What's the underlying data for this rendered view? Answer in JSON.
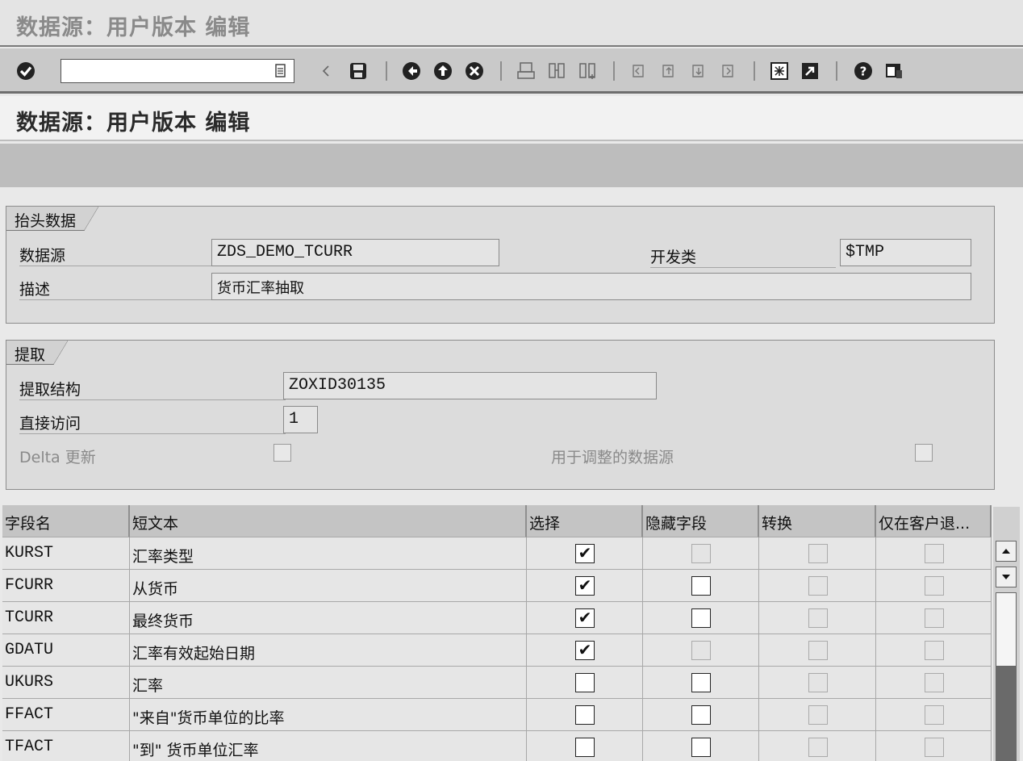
{
  "window": {
    "title": "数据源：用户版本 编辑"
  },
  "toolbar": {
    "command_value": "",
    "icons": [
      "enter-icon",
      "command-history-icon",
      "back-arrow-icon",
      "save-icon",
      "back-icon",
      "exit-icon",
      "cancel-icon",
      "print-icon",
      "find-icon",
      "find-next-icon",
      "first-page-icon",
      "previous-page-icon",
      "next-page-icon",
      "last-page-icon",
      "new-session-icon",
      "create-shortcut-icon",
      "help-icon",
      "layout-menu-icon"
    ]
  },
  "screen": {
    "title": "数据源：用户版本 编辑"
  },
  "header_group": {
    "title": "抬头数据",
    "datasource_label": "数据源",
    "datasource_value": "ZDS_DEMO_TCURR",
    "package_label": "开发类",
    "package_value": "$TMP",
    "description_label": "描述",
    "description_value": "货币汇率抽取"
  },
  "extract_group": {
    "title": "提取",
    "structure_label": "提取结构",
    "structure_value": "ZOXID30135",
    "direct_access_label": "直接访问",
    "direct_access_value": "1",
    "delta_label": "Delta 更新",
    "delta_checked": false,
    "adjust_label": "用于调整的数据源",
    "adjust_checked": false
  },
  "table": {
    "columns": [
      "字段名",
      "短文本",
      "选择",
      "隐藏字段",
      "转换",
      "仅在客户退..."
    ],
    "rows": [
      {
        "field": "KURST",
        "text": "汇率类型",
        "select": true,
        "hide": false,
        "hide_enabled": false
      },
      {
        "field": "FCURR",
        "text": "从货币",
        "select": true,
        "hide": false,
        "hide_enabled": true
      },
      {
        "field": "TCURR",
        "text": "最终货币",
        "select": true,
        "hide": false,
        "hide_enabled": true
      },
      {
        "field": "GDATU",
        "text": "汇率有效起始日期",
        "select": true,
        "hide": false,
        "hide_enabled": false
      },
      {
        "field": "UKURS",
        "text": "汇率",
        "select": false,
        "hide": false,
        "hide_enabled": true
      },
      {
        "field": "FFACT",
        "text": "\"来自\"货币单位的比率",
        "select": false,
        "hide": false,
        "hide_enabled": true
      },
      {
        "field": "TFACT",
        "text": "\"到\" 货币单位汇率",
        "select": false,
        "hide": false,
        "hide_enabled": true
      }
    ]
  }
}
